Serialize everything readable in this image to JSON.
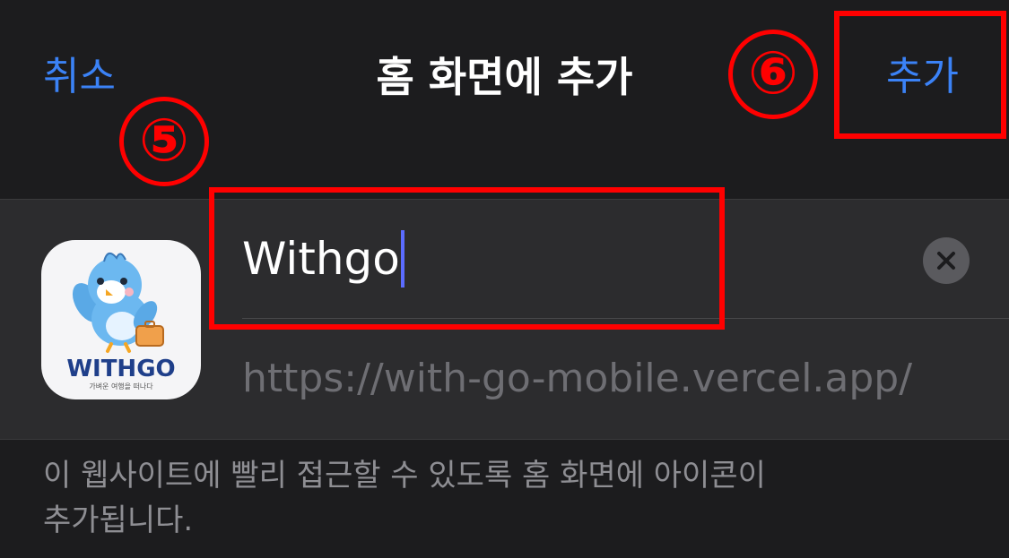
{
  "nav": {
    "cancel_label": "취소",
    "title": "홈 화면에 추가",
    "add_label": "추가"
  },
  "annotations": {
    "step_name_field": "⑤",
    "step_add_button": "⑥",
    "highlight_color": "#ff0000"
  },
  "bookmark": {
    "name_value": "Withgo",
    "url": "https://with-go-mobile.vercel.app/",
    "icon": {
      "name": "withgo-app-icon",
      "brand_text": "WITHGO",
      "tagline": "가벼운 여행을 떠나다"
    }
  },
  "icons": {
    "clear": "clear-x-icon"
  },
  "footer": {
    "line1": "이 웹사이트에 빨리 접근할 수 있도록 홈 화면에 아이콘이",
    "line2": "추가됩니다."
  },
  "colors": {
    "accent": "#3b82f6",
    "background": "#1c1c1e",
    "card": "#2c2c2e",
    "cursor": "#5b6cff"
  }
}
